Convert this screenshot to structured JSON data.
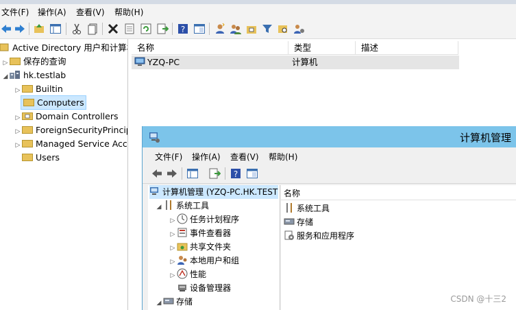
{
  "aduc": {
    "menu": [
      "文件(F)",
      "操作(A)",
      "查看(V)",
      "帮助(H)"
    ],
    "toolbar_icons": [
      "back-arrow-icon",
      "forward-arrow-icon",
      "up-folder-icon",
      "show-tree-icon",
      "cut-icon",
      "copy-icon",
      "delete-icon",
      "properties-icon",
      "refresh-icon",
      "export-icon",
      "help-icon",
      "console-icon",
      "new-user-icon",
      "new-group-icon",
      "new-ou-icon",
      "filter-icon",
      "find-icon",
      "add-to-group-icon"
    ],
    "tree": {
      "root": "Active Directory 用户和计算机",
      "saved_queries": "保存的查询",
      "domain": "hk.testlab",
      "children": [
        "Builtin",
        "Computers",
        "Domain Controllers",
        "ForeignSecurityPrincipals",
        "Managed Service Accounts",
        "Users"
      ],
      "selected": "Computers"
    },
    "list": {
      "columns": [
        "名称",
        "类型",
        "描述"
      ],
      "rows": [
        {
          "name": "YZQ-PC",
          "type": "计算机",
          "desc": ""
        }
      ]
    }
  },
  "cm": {
    "title": "计算机管理",
    "menu": [
      "文件(F)",
      "操作(A)",
      "查看(V)",
      "帮助(H)"
    ],
    "tree": {
      "root": "计算机管理 (YZQ-PC.HK.TEST",
      "system_tools": "系统工具",
      "tools": [
        "任务计划程序",
        "事件查看器",
        "共享文件夹",
        "本地用户和组",
        "性能",
        "设备管理器"
      ],
      "storage": "存储"
    },
    "list": {
      "header": "名称",
      "items": [
        "系统工具",
        "存储",
        "服务和应用程序"
      ]
    }
  },
  "watermark": "CSDN @十三2",
  "colors": {
    "title_bar": "#7cc4ea",
    "selection": "#cce8ff",
    "folder": "#e8c25a"
  }
}
